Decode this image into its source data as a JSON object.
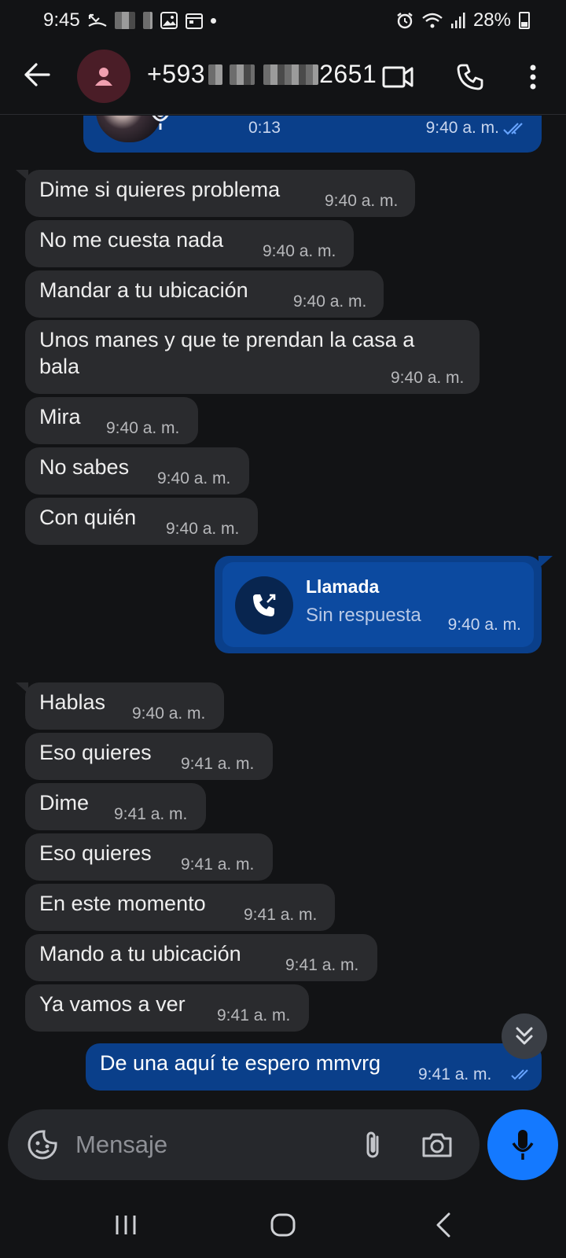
{
  "status_bar": {
    "time": "9:45",
    "battery": "28%"
  },
  "header": {
    "contact_prefix": "+593",
    "contact_suffix": "2651",
    "icons": [
      "back-arrow-icon",
      "person-icon",
      "video-call-icon",
      "phone-icon",
      "more-vert-icon"
    ]
  },
  "voice_message": {
    "duration": "0:13",
    "time": "9:40 a. m."
  },
  "messages": [
    {
      "text": "Dime si quieres problema",
      "time": "9:40 a. m."
    },
    {
      "text": "No me cuesta nada",
      "time": "9:40 a. m."
    },
    {
      "text": "Mandar a tu ubicación",
      "time": "9:40 a. m."
    },
    {
      "line1": "Unos manes y que te prendan la casa a",
      "line2": "bala",
      "time": "9:40 a. m."
    },
    {
      "text": "Mira",
      "time": "9:40 a. m."
    },
    {
      "text": "No sabes",
      "time": "9:40 a. m."
    },
    {
      "text": "Con quién",
      "time": "9:40 a. m."
    },
    {
      "text": "Hablas",
      "time": "9:40 a. m."
    },
    {
      "text": "Eso quieres",
      "time": "9:41 a. m."
    },
    {
      "text": "Dime",
      "time": "9:41 a. m."
    },
    {
      "text": "Eso quieres",
      "time": "9:41 a. m."
    },
    {
      "text": "En este momento",
      "time": "9:41 a. m."
    },
    {
      "text": "Mando a tu ubicación",
      "time": "9:41 a. m."
    },
    {
      "text": "Ya vamos a ver",
      "time": "9:41 a. m."
    }
  ],
  "call_card": {
    "title": "Llamada",
    "subtitle": "Sin respuesta",
    "time": "9:40 a. m."
  },
  "sent_message": {
    "text": "De una aquí te espero mmvrg",
    "time": "9:41 a. m."
  },
  "composer": {
    "placeholder": "Mensaje"
  },
  "colors": {
    "background": "#121315",
    "received_bubble": "#2a2b2e",
    "sent_bubble": "#0a3f8a",
    "mic_button": "#1479ff"
  }
}
